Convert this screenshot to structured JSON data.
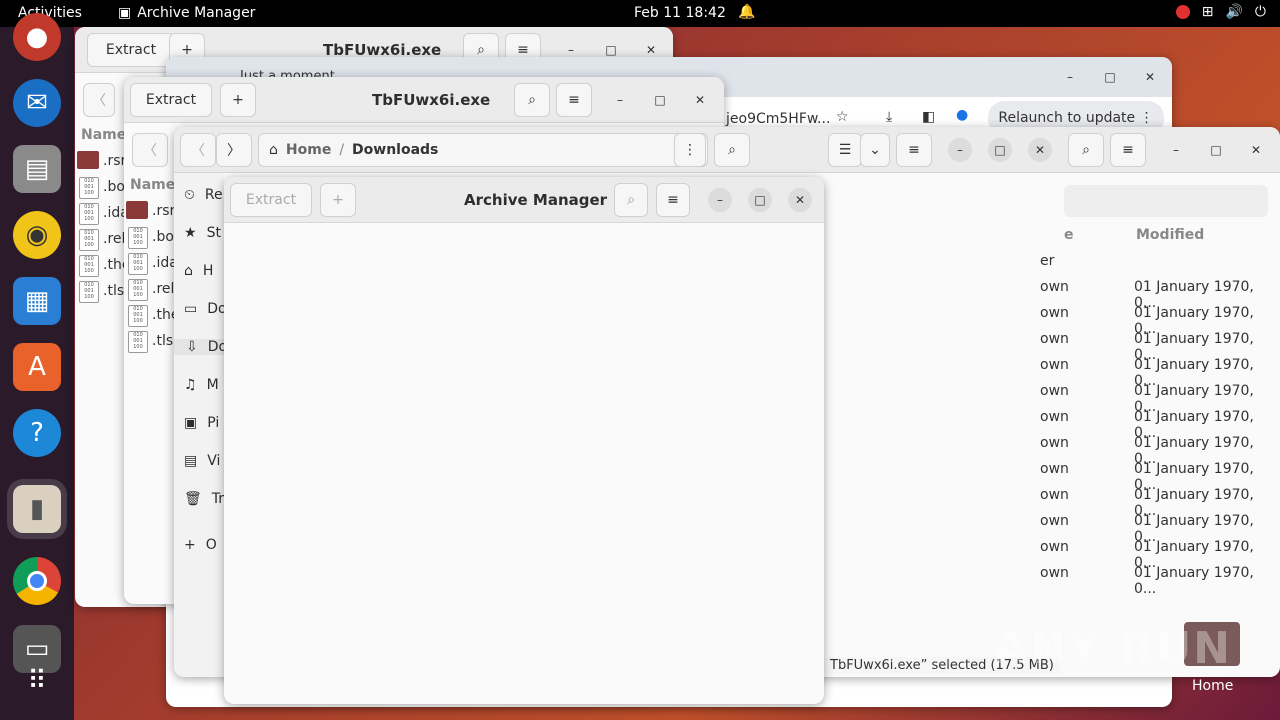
{
  "topbar": {
    "activities": "Activities",
    "app_name": "Archive Manager",
    "clock": "Feb 11  18:42"
  },
  "dock": {
    "items": [
      "firefox-icon",
      "thunderbird-icon",
      "files-icon",
      "rhythmbox-icon",
      "writer-icon",
      "software-icon",
      "help-icon",
      "archive-manager-icon",
      "chrome-icon",
      "drive-icon",
      "apps-grid-icon"
    ]
  },
  "win1": {
    "extract": "Extract",
    "title": "TbFUwx6i.exe",
    "col_name": "Name",
    "files": [
      ".rsr",
      ".bo",
      ".ida",
      ".rel",
      ".the",
      ".tls"
    ]
  },
  "browser": {
    "tab": "Just a moment...",
    "url": "jeo9Cm5HFw...",
    "relaunch": "Relaunch to update"
  },
  "win2": {
    "extract": "Extract",
    "title": "TbFUwx6i.exe",
    "col_name": "Name",
    "files": [
      ".rsr",
      ".bo",
      ".ida",
      ".rel",
      ".the",
      ".tls"
    ]
  },
  "files": {
    "path_home": "Home",
    "path_sep": "/",
    "path_current": "Downloads",
    "col_modified": "Modified",
    "col_size_fragment": "e",
    "first_row_fragment": "er",
    "row_size_fragment": "own",
    "row_date": "01 January 1970, 0...",
    "rows": 12,
    "status": "TbFUwx6i.exe” selected  (17.5 MB)",
    "sidebar": [
      {
        "icon": "clock-icon",
        "label": "Re"
      },
      {
        "icon": "star-icon",
        "label": "St"
      },
      {
        "icon": "home-icon",
        "label": "H"
      },
      {
        "icon": "document-icon",
        "label": "Do"
      },
      {
        "icon": "download-icon",
        "label": "Do"
      },
      {
        "icon": "music-icon",
        "label": "M"
      },
      {
        "icon": "picture-icon",
        "label": "Pi"
      },
      {
        "icon": "video-icon",
        "label": "Vi"
      },
      {
        "icon": "trash-icon",
        "label": "Tr"
      },
      {
        "icon": "plus-icon",
        "label": "O"
      }
    ]
  },
  "archive": {
    "extract": "Extract",
    "title": "Archive Manager"
  },
  "desktop": {
    "home_label": "Home",
    "watermark": "ANY RUN"
  }
}
